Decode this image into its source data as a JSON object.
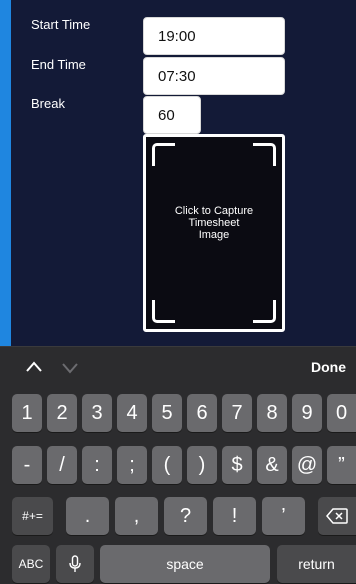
{
  "form": {
    "start_time_label": "Start Time",
    "start_time_value": "19:00",
    "end_time_label": "End Time",
    "end_time_value": "07:30",
    "break_label": "Break",
    "break_value": "60",
    "capture_text": "Click to Capture\nTimesheet\nImage"
  },
  "keyboard_toolbar": {
    "done_label": "Done"
  },
  "keyboard": {
    "row1": [
      "1",
      "2",
      "3",
      "4",
      "5",
      "6",
      "7",
      "8",
      "9",
      "0"
    ],
    "row2": [
      "-",
      "/",
      ":",
      ";",
      "(",
      ")",
      "$",
      "&",
      "@",
      "”"
    ],
    "row3": [
      ".",
      ",",
      "?",
      "!",
      "’"
    ],
    "symbols_key": "#+=",
    "abc_key": "ABC",
    "space_key": "space",
    "return_key": "return"
  },
  "colors": {
    "form_background": "#131a37",
    "accent_blue": "#1a7fd8",
    "keyboard_background": "#2c2c2e"
  }
}
